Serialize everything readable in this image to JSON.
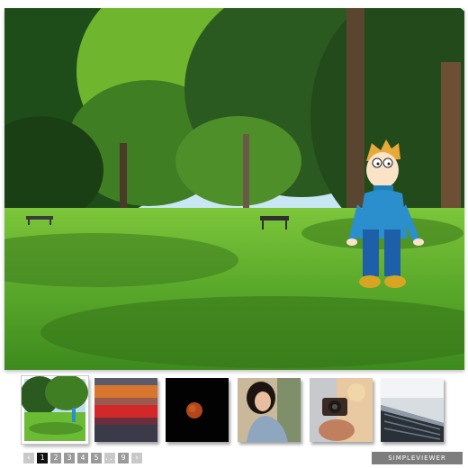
{
  "viewer": {
    "main_image": {
      "alt": "Park with tall trees, benches and a cartoon character",
      "icon": "main-photo"
    },
    "thumbnails": [
      {
        "icon": "park-thumbnail",
        "selected": true
      },
      {
        "icon": "sunset-sea-thumbnail",
        "selected": false
      },
      {
        "icon": "lunar-eclipse-thumbnail",
        "selected": false
      },
      {
        "icon": "woman-portrait-thumbnail",
        "selected": false
      },
      {
        "icon": "camera-photographer-thumbnail",
        "selected": false
      },
      {
        "icon": "building-architecture-thumbnail",
        "selected": false
      }
    ],
    "pagination": {
      "prev": "‹",
      "pages": [
        "1",
        "2",
        "3",
        "4",
        "5",
        "...",
        "9"
      ],
      "active_page": "1",
      "next": "›"
    },
    "credit_button": "SIMPLEVIEWER",
    "colors": {
      "active_page": "#111111",
      "page": "#9a9a9a",
      "credit_bg": "#7d7d7d"
    }
  }
}
